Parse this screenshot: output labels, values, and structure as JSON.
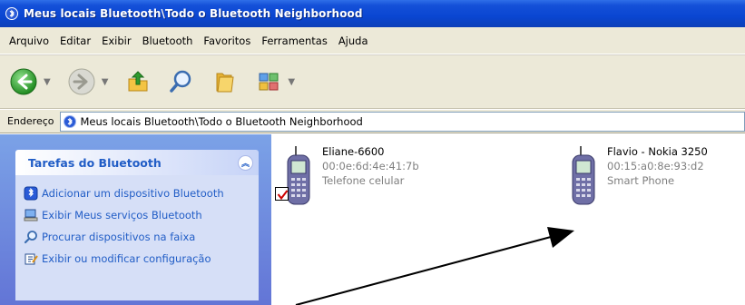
{
  "window": {
    "title": "Meus locais Bluetooth\\Todo o Bluetooth Neighborhood"
  },
  "menu": [
    "Arquivo",
    "Editar",
    "Exibir",
    "Bluetooth",
    "Favoritos",
    "Ferramentas",
    "Ajuda"
  ],
  "address": {
    "label": "Endereço",
    "value": "Meus locais Bluetooth\\Todo o Bluetooth Neighborhood"
  },
  "tasks": {
    "title": "Tarefas do Bluetooth",
    "items": [
      "Adicionar um dispositivo Bluetooth",
      "Exibir Meus serviços Bluetooth",
      "Procurar dispositivos na faixa",
      "Exibir ou modificar configuração"
    ]
  },
  "devices": [
    {
      "name": "Eliane-6600",
      "address": "00:0e:6d:4e:41:7b",
      "type": "Telefone celular",
      "checked": true
    },
    {
      "name": "Flavio - Nokia 3250",
      "address": "00:15:a0:8e:93:d2",
      "type": "Smart Phone",
      "checked": false
    }
  ],
  "colors": {
    "titlebar": "#0a46d2",
    "task_link": "#215dc6",
    "check": "#cc0000",
    "annotation": "#000000"
  },
  "icons": [
    "back-icon",
    "forward-icon",
    "up-folder-icon",
    "search-icon",
    "folders-icon",
    "views-icon",
    "bluetooth-icon",
    "mobile-phone-icon"
  ]
}
